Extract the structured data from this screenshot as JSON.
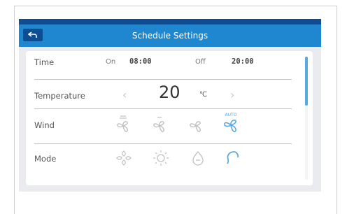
{
  "header": {
    "title": "Schedule Settings"
  },
  "rows": {
    "time": {
      "label": "Time",
      "on_label": "On",
      "on_value": "08:00",
      "off_label": "Off",
      "off_value": "20:00"
    },
    "temperature": {
      "label": "Temperature",
      "value": "20",
      "unit": "℃"
    },
    "wind": {
      "label": "Wind",
      "selected": "auto",
      "auto_label": "AUTO",
      "options": [
        "fan-low-icon",
        "fan-medium-icon",
        "fan-high-icon",
        "fan-auto-icon"
      ]
    },
    "mode": {
      "label": "Mode",
      "selected": "heat",
      "options": [
        "cool-icon",
        "heat-icon",
        "dry-icon",
        "fan-mode-icon"
      ]
    }
  },
  "colors": {
    "header": "#1e87cf",
    "header_top": "#0c4d93",
    "accent": "#5aa8e0",
    "inactive_icon": "#c0c0c0"
  }
}
